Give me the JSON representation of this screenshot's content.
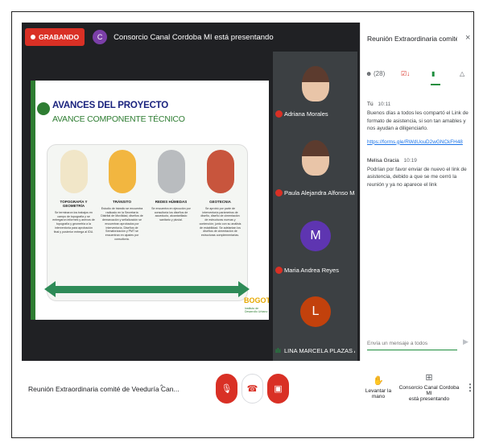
{
  "topbar": {
    "recording_label": "GRABANDO",
    "presenter_initial": "C",
    "presenting_text": "Consorcio Canal Cordoba MI está presentando"
  },
  "slide": {
    "title": "AVANCES DEL PROYECTO",
    "subtitle": "AVANCE COMPONENTE TÉCNICO",
    "cards": [
      {
        "title": "TOPOGRAFÍA Y GEOMETRÍA",
        "body": "Se terminaron los trabajos en campo de topografía y se entregaron informes y anexos de topografía y geometría a la interventoría para aprobación final y posterior entrega al IDU."
      },
      {
        "title": "TRÁNSITO",
        "body": "Estudio de tránsito se encuentra radicado en la Secretaría Distrital de Movilidad, diseños de demarcación y señalización se encuentran aprobados por interventoría. Diseños de Semaforización y PMT se encuentran en ajustes por consultoría."
      },
      {
        "title": "REDES HÚMEDAS",
        "body": "Se encuentra en ejecución por consultoría los diseños de acueducto, alcantarillado sanitario y pluvial."
      },
      {
        "title": "GEOTECNIA",
        "body": "Se aprobó por parte de interventoría parámetros de diseño, diseño de cimentación de estructuras nuevas y contención; junto con su análisis de estabilidad. Se adelantan los diseños de cimentación de estructuras complementarias."
      }
    ],
    "logo": "BOGOTÁ",
    "logo_sub": "Instituto de Desarrollo Urbano"
  },
  "participants": [
    {
      "name": "Adriana Morales",
      "type": "photo"
    },
    {
      "name": "Paula Alejandra Alfonso Martin...",
      "type": "photo"
    },
    {
      "name": "Maria Andrea Reyes",
      "type": "letter",
      "initial": "M",
      "color": "#5e35b1"
    },
    {
      "name": "LINA MARCELA PLAZAS ACEV...",
      "type": "letter",
      "initial": "L",
      "color": "#c2410c"
    }
  ],
  "panel": {
    "title": "Reunión Extraordinaria comité de V...",
    "close_icon": "×",
    "people_count": "(28)",
    "messages": [
      {
        "sender": "Tú",
        "time": "10:11",
        "text": "Buenos días a todos les compartó el Link de formato de asistencia, si son tan amables y nos ayudan a diligenciarlo.",
        "link": "https://forms.gle/RWdUouD2wGNCkFH48"
      },
      {
        "sender": "Melisa Gracia",
        "time": "10:19",
        "text": "Podrían por favor enviar de nuevo el link de asistencia, debido a que se me cerró la reunión y ya no aparece el link"
      }
    ],
    "input_placeholder": "Envía un mensaje a todos"
  },
  "bottom": {
    "meeting_name": "Reunión Extraordinaria comité de Veeduría Can...",
    "raise_hand": "Levantar la mano",
    "presenting_line1": "Consorcio Canal Cordoba MI",
    "presenting_line2": "está presentando"
  },
  "colors": {
    "accent_green": "#1e8e3e",
    "red": "#d93025",
    "stage": "#202124"
  }
}
